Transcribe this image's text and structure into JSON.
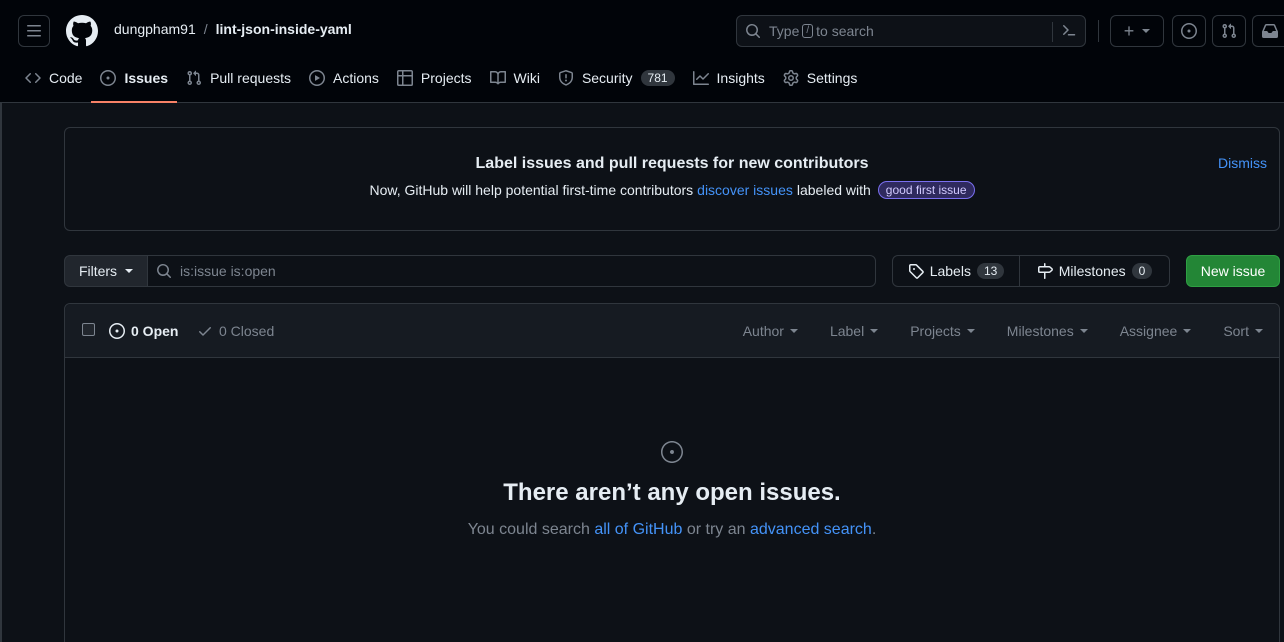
{
  "header": {
    "owner": "dungpham91",
    "separator": "/",
    "repo": "lint-json-inside-yaml",
    "search_prefix": "Type",
    "search_key": "/",
    "search_suffix": "to search",
    "create_label": "+"
  },
  "nav": {
    "items": [
      {
        "label": "Code"
      },
      {
        "label": "Issues"
      },
      {
        "label": "Pull requests"
      },
      {
        "label": "Actions"
      },
      {
        "label": "Projects"
      },
      {
        "label": "Wiki"
      },
      {
        "label": "Security",
        "count": "781"
      },
      {
        "label": "Insights"
      },
      {
        "label": "Settings"
      }
    ]
  },
  "banner": {
    "title": "Label issues and pull requests for new contributors",
    "text_before": "Now, GitHub will help potential first-time contributors",
    "link": "discover issues",
    "text_after": "labeled with",
    "label": "good first issue",
    "dismiss": "Dismiss"
  },
  "toolbar": {
    "filters": "Filters",
    "query": "is:issue is:open",
    "labels": "Labels",
    "labels_count": "13",
    "milestones": "Milestones",
    "milestones_count": "0",
    "new_issue": "New issue"
  },
  "issues": {
    "open": "0 Open",
    "closed": "0 Closed",
    "sorters": [
      "Author",
      "Label",
      "Projects",
      "Milestones",
      "Assignee",
      "Sort"
    ],
    "empty_title": "There aren’t any open issues.",
    "empty_before": "You could search",
    "empty_link1": "all of GitHub",
    "empty_middle": "or try an",
    "empty_link2": "advanced search",
    "empty_end": "."
  },
  "colors": {
    "background": "#0d1117",
    "accent_link": "#4493f8",
    "primary_button": "#238636",
    "active_tab_underline": "#f78166"
  }
}
